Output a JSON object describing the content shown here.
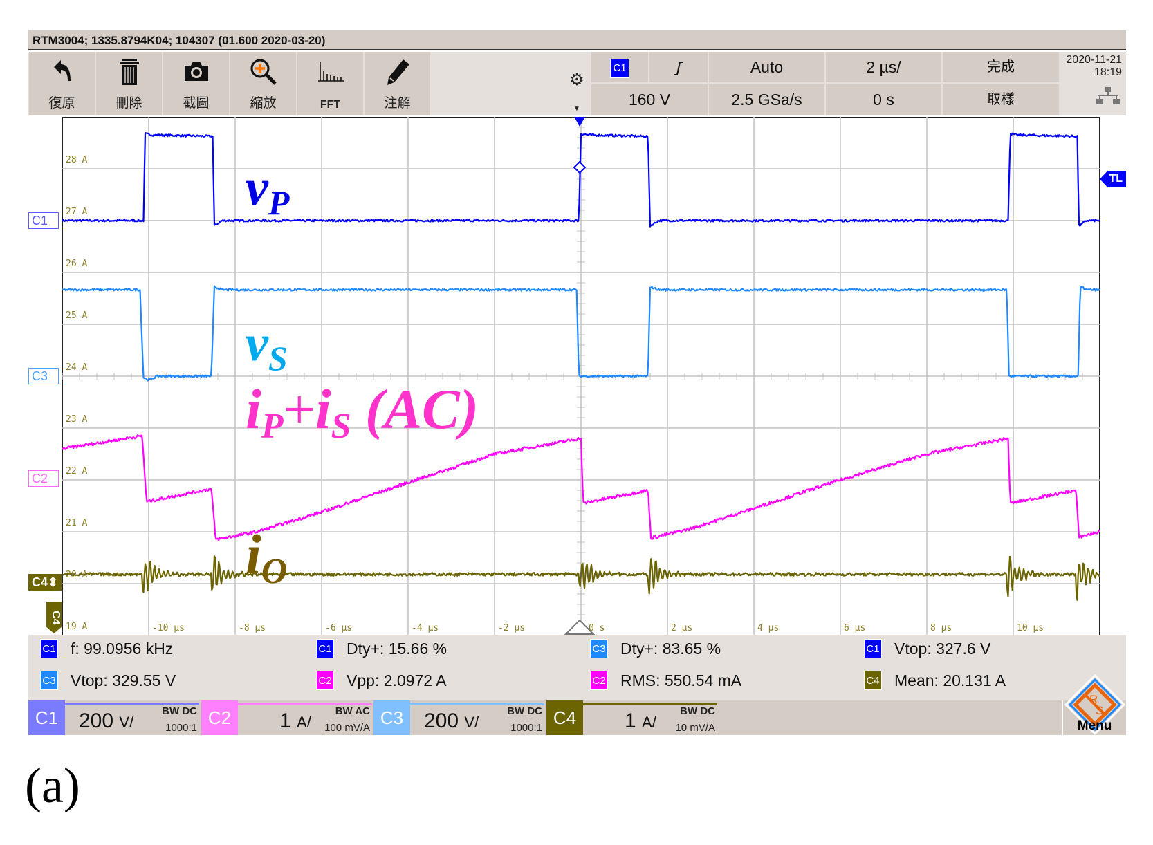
{
  "title_bar": "RTM3004; 1335.8794K04; 104307 (01.600 2020-03-20)",
  "toolbar": [
    {
      "label": "復原",
      "icon": "undo-icon"
    },
    {
      "label": "刪除",
      "icon": "trash-icon"
    },
    {
      "label": "截圖",
      "icon": "camera-icon"
    },
    {
      "label": "縮放",
      "icon": "zoom-icon"
    },
    {
      "label": "FFT",
      "icon": "fft-icon"
    },
    {
      "label": "注解",
      "icon": "pencil-icon"
    }
  ],
  "trigger": {
    "source": "C1",
    "slope": "rising-edge",
    "mode": "Auto",
    "level": "160 V",
    "timebase": "2 µs/",
    "sample_rate": "2.5 GSa/s",
    "position": "0 s",
    "status": "完成",
    "acq": "取樣"
  },
  "datetime": {
    "date": "2020-11-21",
    "time": "18:19"
  },
  "markers": {
    "c1": "C1",
    "c2": "C2",
    "c3": "C3",
    "c4": "C4",
    "tl": "TL"
  },
  "annotations": {
    "vp": "v",
    "vp_sub": "P",
    "vs": "v",
    "vs_sub": "S",
    "ipis_a": "i",
    "ipis_a_sub": "P",
    "ipis_plus": "+",
    "ipis_b": "i",
    "ipis_b_sub": "S",
    "ipis_ac": " (AC)",
    "io": "i",
    "io_sub": "O"
  },
  "measurements": [
    {
      "ch": "C1",
      "color": "#0000ff",
      "text": "f: 99.0956 kHz"
    },
    {
      "ch": "C1",
      "color": "#0000ff",
      "text": "Dty+: 15.66 %"
    },
    {
      "ch": "C3",
      "color": "#1e88ff",
      "text": "Dty+: 83.65 %"
    },
    {
      "ch": "C1",
      "color": "#0000ff",
      "text": "Vtop: 327.6 V"
    },
    {
      "ch": "C3",
      "color": "#1e88ff",
      "text": "Vtop: 329.55 V"
    },
    {
      "ch": "C2",
      "color": "#ff00ff",
      "text": "Vpp: 2.0972 A"
    },
    {
      "ch": "C2",
      "color": "#ff00ff",
      "text": "RMS: 550.54 mA"
    },
    {
      "ch": "C4",
      "color": "#6b6400",
      "text": "Mean: 20.131 A"
    }
  ],
  "channels": [
    {
      "name": "C1",
      "scale": "200",
      "unit": "V/",
      "bw": "BW DC",
      "probe": "1000:1",
      "color": "#7b7bff",
      "line": "#7b7bff"
    },
    {
      "name": "C2",
      "scale": "1",
      "unit": "A/",
      "bw": "BW AC",
      "probe": "100 mV/A",
      "color": "#ff80ff",
      "line": "#ff80ff"
    },
    {
      "name": "C3",
      "scale": "200",
      "unit": "V/",
      "bw": "BW DC",
      "probe": "1000:1",
      "color": "#80c0ff",
      "line": "#80c0ff"
    },
    {
      "name": "C4",
      "scale": "1",
      "unit": "A/",
      "bw": "BW DC",
      "probe": "10 mV/A",
      "color": "#6b6400",
      "line": "#6b6400"
    }
  ],
  "menu_label": "Menu",
  "logo_text": "R&S",
  "caption": "(a)",
  "chart_data": {
    "type": "line",
    "x_unit": "µs",
    "xlim": [
      -12,
      12
    ],
    "x_ticks": [
      -10,
      -8,
      -6,
      -4,
      -2,
      0,
      2,
      4,
      6,
      8,
      10
    ],
    "x_tick_labels": [
      "-10 µs",
      "-8 µs",
      "-6 µs",
      "-4 µs",
      "-2 µs",
      "0 s",
      "2 µs",
      "4 µs",
      "6 µs",
      "8 µs",
      "10 µs"
    ],
    "y_tick_labels": [
      "28 A",
      "27 A",
      "26 A",
      "25 A",
      "24 A",
      "23 A",
      "22 A",
      "21 A",
      "20 A",
      "19 A"
    ],
    "grid": true,
    "series": [
      {
        "name": "C1 vP",
        "unit": "V",
        "color": "#0000ff",
        "offset_div": 3,
        "per_div": 200,
        "noise": 4,
        "points": [
          [
            -12,
            0
          ],
          [
            -10.12,
            0
          ],
          [
            -10.08,
            335
          ],
          [
            -9.9,
            330
          ],
          [
            -8.52,
            325
          ],
          [
            -8.48,
            -20
          ],
          [
            -8.3,
            0
          ],
          [
            -0.05,
            0
          ],
          [
            0,
            335
          ],
          [
            0.2,
            330
          ],
          [
            1.55,
            325
          ],
          [
            1.6,
            -20
          ],
          [
            1.8,
            0
          ],
          [
            9.88,
            0
          ],
          [
            9.93,
            335
          ],
          [
            10.1,
            330
          ],
          [
            11.48,
            325
          ],
          [
            11.52,
            -20
          ],
          [
            11.7,
            0
          ],
          [
            12,
            0
          ]
        ]
      },
      {
        "name": "C3 vS",
        "unit": "V",
        "color": "#1e88ff",
        "offset_div": 0,
        "per_div": 200,
        "noise": 4,
        "points": [
          [
            -12,
            333
          ],
          [
            -10.2,
            333
          ],
          [
            -10.12,
            -5
          ],
          [
            -10,
            -15
          ],
          [
            -9.8,
            0
          ],
          [
            -8.55,
            0
          ],
          [
            -8.48,
            345
          ],
          [
            -8.3,
            333
          ],
          [
            -0.1,
            333
          ],
          [
            -0.05,
            0
          ],
          [
            1.55,
            0
          ],
          [
            1.6,
            345
          ],
          [
            1.8,
            333
          ],
          [
            9.85,
            333
          ],
          [
            9.9,
            0
          ],
          [
            11.5,
            0
          ],
          [
            11.55,
            345
          ],
          [
            11.7,
            333
          ],
          [
            12,
            333
          ]
        ]
      },
      {
        "name": "C2 iP+iS (AC)",
        "unit": "A",
        "color": "#ff00ff",
        "offset_div": -2,
        "per_div": 1,
        "noise": 0.03,
        "points": [
          [
            -12,
            0.6
          ],
          [
            -10.15,
            0.85
          ],
          [
            -10.05,
            -0.42
          ],
          [
            -8.55,
            -0.17
          ],
          [
            -8.45,
            -1.15
          ],
          [
            -7.5,
            -1.0
          ],
          [
            -6,
            -0.62
          ],
          [
            -4,
            -0.05
          ],
          [
            -2,
            0.5
          ],
          [
            0,
            0.8
          ],
          [
            0.05,
            -0.45
          ],
          [
            1.55,
            -0.2
          ],
          [
            1.62,
            -1.12
          ],
          [
            2.5,
            -0.95
          ],
          [
            4,
            -0.55
          ],
          [
            6,
            0.0
          ],
          [
            8,
            0.5
          ],
          [
            9.88,
            0.8
          ],
          [
            9.93,
            -0.45
          ],
          [
            11.45,
            -0.2
          ],
          [
            11.52,
            -1.1
          ],
          [
            12,
            -1.0
          ]
        ]
      },
      {
        "name": "C4 iO",
        "unit": "A",
        "color": "#6b6400",
        "offset_div": 0,
        "per_div": 1,
        "base_A": 20.18,
        "noise": 0.03,
        "ringing_at_us": [
          -10.1,
          -8.5,
          0,
          1.6,
          9.9,
          11.5
        ],
        "points": [
          [
            -12,
            20.18
          ],
          [
            12,
            20.18
          ]
        ]
      }
    ]
  }
}
